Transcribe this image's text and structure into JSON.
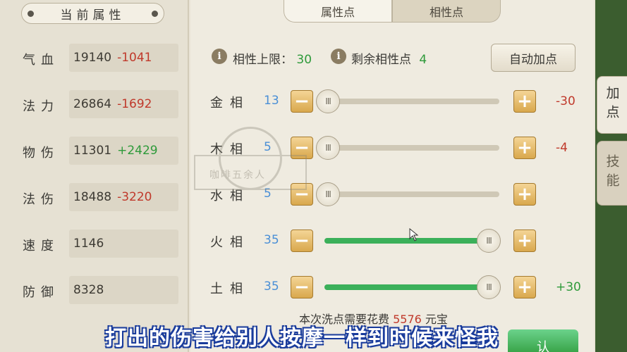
{
  "left_panel": {
    "title": "当前属性",
    "stats": [
      {
        "label": "气血",
        "value": "19140",
        "delta": "-1041",
        "sign": "neg"
      },
      {
        "label": "法力",
        "value": "26864",
        "delta": "-1692",
        "sign": "neg"
      },
      {
        "label": "物伤",
        "value": "11301",
        "delta": "+2429",
        "sign": "pos"
      },
      {
        "label": "法伤",
        "value": "18488",
        "delta": "-3220",
        "sign": "neg"
      },
      {
        "label": "速度",
        "value": "1146",
        "delta": "",
        "sign": ""
      },
      {
        "label": "防御",
        "value": "8328",
        "delta": "",
        "sign": ""
      }
    ]
  },
  "tabs": [
    {
      "label": "属性点",
      "active": false
    },
    {
      "label": "相性点",
      "active": true
    }
  ],
  "info": {
    "icon": "i",
    "limit_label": "相性上限：",
    "limit_value": "30",
    "remaining_label": "剩余相性点",
    "remaining_value": "4"
  },
  "auto_button": "自动加点",
  "affinities": [
    {
      "label": "金相",
      "value": "13",
      "fill": 0,
      "delta": "-30",
      "sign": "neg"
    },
    {
      "label": "木相",
      "value": "5",
      "fill": 0,
      "delta": "-4",
      "sign": "neg"
    },
    {
      "label": "水相",
      "value": "5",
      "fill": 0,
      "delta": "",
      "sign": ""
    },
    {
      "label": "火相",
      "value": "35",
      "fill": 1,
      "delta": "",
      "sign": ""
    },
    {
      "label": "土相",
      "value": "35",
      "fill": 1,
      "delta": "+30",
      "sign": "pos"
    }
  ],
  "stepper": {
    "minus": "−",
    "plus": "+",
    "thumb": "III"
  },
  "cost": {
    "prefix": "本次洗点需要花费",
    "amount": "5576",
    "suffix": "元宝"
  },
  "side_tabs": [
    {
      "label": "加点",
      "active": true
    },
    {
      "label": "技能",
      "active": false
    }
  ],
  "watermark_text": "咖啡五余人",
  "subtitle": "打出的伤害给别人按摩一样到时候来怪我",
  "confirm_partial": "认",
  "colors": {
    "negative": "#c0392b",
    "positive": "#2e9a3a",
    "affinity_value": "#4a8fd6",
    "slider_fill": "#3bb05a",
    "subtitle_outline": "#1a3c9c"
  }
}
